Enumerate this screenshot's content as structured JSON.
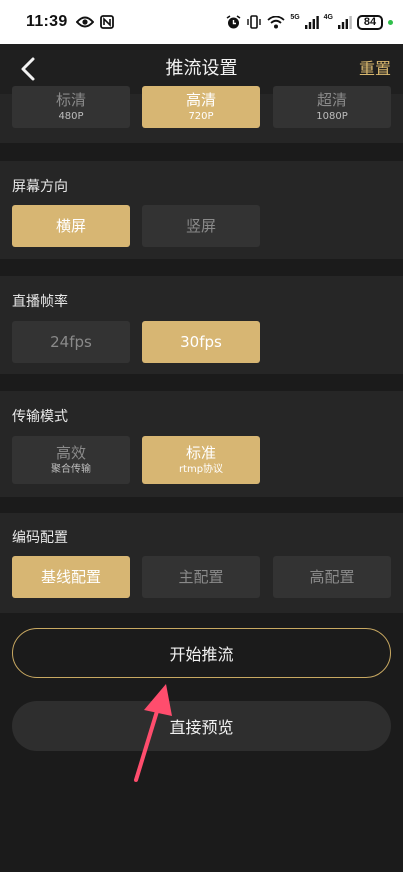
{
  "status_bar": {
    "time": "11:39",
    "battery": "84",
    "net_5g": "5G",
    "net_4g": "4G"
  },
  "header": {
    "title": "推流设置",
    "reset_label": "重置"
  },
  "sections": {
    "resolution": {
      "options": [
        {
          "label": "标清",
          "sub": "480P",
          "selected": false
        },
        {
          "label": "高清",
          "sub": "720P",
          "selected": true
        },
        {
          "label": "超清",
          "sub": "1080P",
          "selected": false
        }
      ]
    },
    "orientation": {
      "title": "屏幕方向",
      "options": [
        {
          "label": "横屏",
          "selected": true
        },
        {
          "label": "竖屏",
          "selected": false
        }
      ]
    },
    "framerate": {
      "title": "直播帧率",
      "options": [
        {
          "label": "24fps",
          "selected": false
        },
        {
          "label": "30fps",
          "selected": true
        }
      ]
    },
    "transport": {
      "title": "传输模式",
      "options": [
        {
          "label": "高效",
          "sub": "聚合传输",
          "selected": false
        },
        {
          "label": "标准",
          "sub": "rtmp协议",
          "selected": true
        }
      ]
    },
    "encoding": {
      "title": "编码配置",
      "options": [
        {
          "label": "基线配置",
          "selected": true
        },
        {
          "label": "主配置",
          "selected": false
        },
        {
          "label": "高配置",
          "selected": false
        }
      ]
    }
  },
  "buttons": {
    "start": "开始推流",
    "preview": "直接预览"
  },
  "colors": {
    "accent": "#d7b673",
    "background": "#1b1b1b",
    "section": "#262626",
    "option": "#333333",
    "arrow": "#ff4d6d"
  }
}
